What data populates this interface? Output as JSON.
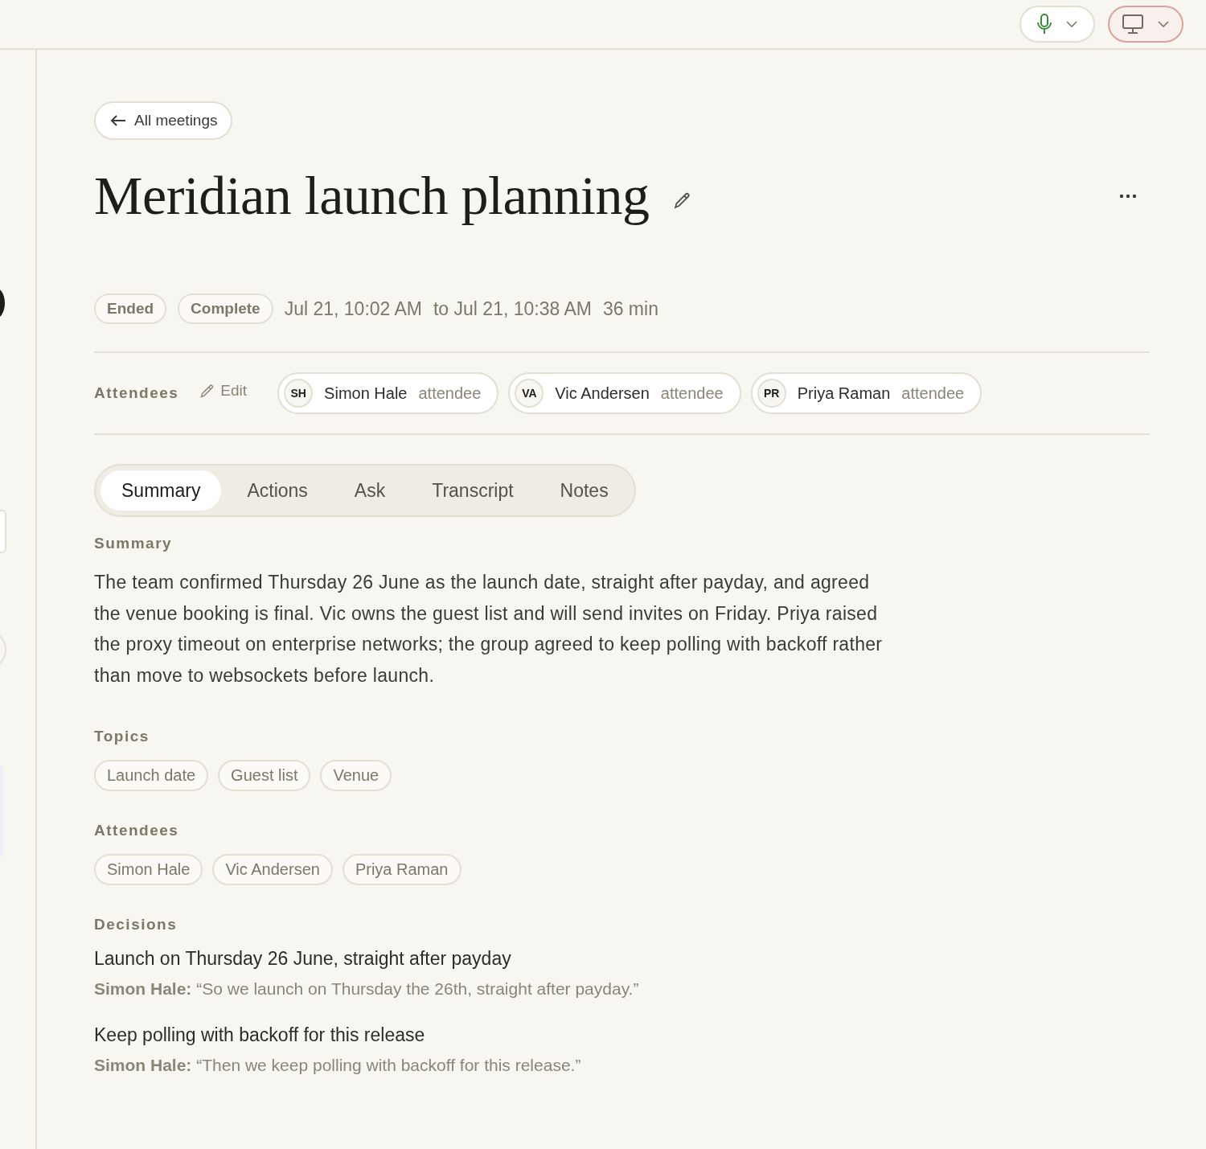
{
  "toolbar": {
    "buttons": [
      {
        "kind": "mic",
        "highlighted": false
      },
      {
        "kind": "screen",
        "highlighted": true
      }
    ]
  },
  "back_link": {
    "label": "All meetings"
  },
  "title": "Meridian launch planning",
  "status": {
    "badges": [
      "Ended",
      "Complete"
    ],
    "time_range": [
      "Jul 21, 10:02 AM",
      "to Jul 21, 10:38 AM"
    ],
    "duration": "36 min"
  },
  "attendees_bar": {
    "label": "Attendees",
    "edit": "Edit",
    "people": [
      {
        "initials": "SH",
        "name": "Simon Hale",
        "role": "attendee"
      },
      {
        "initials": "VA",
        "name": "Vic Andersen",
        "role": "attendee"
      },
      {
        "initials": "PR",
        "name": "Priya Raman",
        "role": "attendee"
      }
    ]
  },
  "tabs": [
    {
      "label": "Summary",
      "selected": true
    },
    {
      "label": "Actions",
      "selected": false
    },
    {
      "label": "Ask",
      "selected": false
    },
    {
      "label": "Transcript",
      "selected": false
    },
    {
      "label": "Notes",
      "selected": false
    }
  ],
  "summary": {
    "heading": "Summary",
    "text": "The team confirmed Thursday 26 June as the launch date, straight after payday, and agreed the venue booking is final. Vic owns the guest list and will send invites on Friday. Priya raised the proxy timeout on enterprise networks; the group agreed to keep polling with backoff rather than move to websockets before launch."
  },
  "topics": {
    "heading": "Topics",
    "items": [
      "Launch date",
      "Guest list",
      "Venue"
    ]
  },
  "attendees": {
    "heading": "Attendees",
    "items": [
      "Simon Hale",
      "Vic Andersen",
      "Priya Raman"
    ]
  },
  "decisions": {
    "heading": "Decisions",
    "items": [
      {
        "text": "Launch on Thursday 26 June, straight after payday",
        "speaker": "Simon Hale:",
        "quote": "“So we launch on Thursday the 26th, straight after payday.”"
      },
      {
        "text": "Keep polling with backoff for this release",
        "speaker": "Simon Hale:",
        "quote": "“Then we keep polling with backoff for this release.”"
      }
    ]
  }
}
